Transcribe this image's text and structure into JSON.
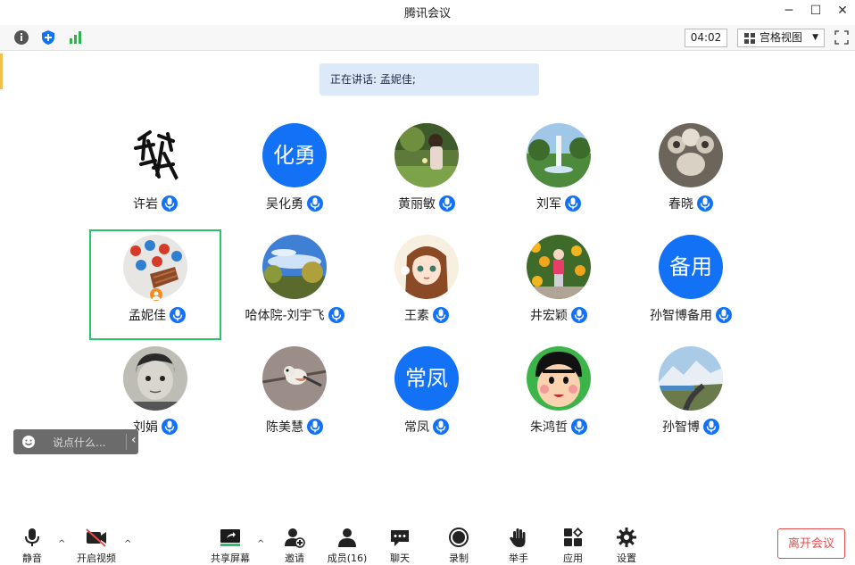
{
  "window": {
    "title": "腾讯会议"
  },
  "topbar": {
    "timer": "04:02",
    "view_label": "宫格视图"
  },
  "speaking_banner": "正在讲话: 孟妮佳;",
  "participants": [
    {
      "name": "许岩",
      "avatar": "calligraphy-avatar"
    },
    {
      "name": "吴化勇",
      "avatar_text": "化勇"
    },
    {
      "name": "黄丽敏",
      "avatar": "photo-girl-garden"
    },
    {
      "name": "刘军",
      "avatar": "photo-fountain"
    },
    {
      "name": "春晓",
      "avatar": "photo-cat-paw"
    },
    {
      "name": "孟妮佳",
      "avatar": "photo-candy",
      "active": true,
      "host": true
    },
    {
      "name": "哈体院-刘宇飞",
      "avatar": "photo-sky-trees"
    },
    {
      "name": "王素",
      "avatar": "anime-girl"
    },
    {
      "name": "井宏颖",
      "avatar": "photo-child-flowers"
    },
    {
      "name": "孙智博备用",
      "avatar_text": "备用"
    },
    {
      "name": "刘娟",
      "avatar": "photo-child-bw"
    },
    {
      "name": "陈美慧",
      "avatar": "photo-bird"
    },
    {
      "name": "常凤",
      "avatar_text": "常凤"
    },
    {
      "name": "朱鸿哲",
      "avatar": "cartoon-boy"
    },
    {
      "name": "孙智博",
      "avatar": "photo-mountain-road"
    }
  ],
  "chat": {
    "placeholder": "说点什么..."
  },
  "toolbar": {
    "mute": "静音",
    "video": "开启视频",
    "share": "共享屏幕",
    "invite": "邀请",
    "members": "成员(16)",
    "chat": "聊天",
    "record": "录制",
    "raise_hand": "举手",
    "apps": "应用",
    "settings": "设置",
    "leave": "离开会议"
  },
  "colors": {
    "accent": "#1271f5",
    "active_border": "#27c46a",
    "leave": "#e84c4c",
    "host": "#f38b1d"
  }
}
